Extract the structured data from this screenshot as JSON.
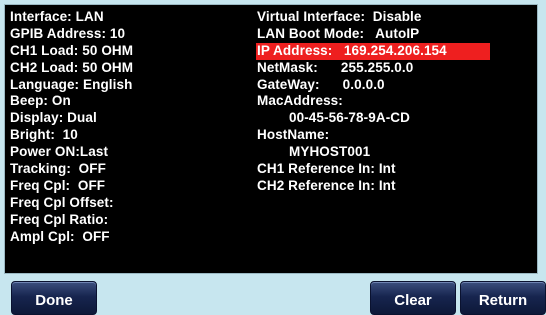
{
  "left_column": [
    "Interface: LAN",
    "GPIB Address: 10",
    "CH1 Load: 50 OHM",
    "CH2 Load: 50 OHM",
    "Language: English",
    "Beep: On",
    "Display: Dual",
    "Bright:  10",
    "Power ON:Last",
    "Tracking:  OFF",
    "Freq Cpl:  OFF",
    "Freq Cpl Offset:",
    "Freq Cpl Ratio:",
    "Ampl Cpl:  OFF"
  ],
  "right_column": {
    "virtual_interface": "Virtual Interface:  Disable",
    "lan_boot_mode": "LAN Boot Mode:   AutoIP",
    "ip_address": "IP Address:   169.254.206.154",
    "netmask": "NetMask:      255.255.0.0",
    "gateway": "GateWay:      0.0.0.0",
    "mac_address_label": "MacAddress:",
    "mac_address_value": "00-45-56-78-9A-CD",
    "hostname_label": "HostName:",
    "hostname_value": "MYHOST001",
    "ch1_reference": "CH1 Reference In: Int",
    "ch2_reference": "CH2 Reference In: Int"
  },
  "softkeys": {
    "done": "Done",
    "clear": "Clear",
    "return": "Return"
  },
  "colors": {
    "background": "#c7e6ef",
    "panel": "#000000",
    "highlight": "#ee1f1f",
    "text": "#ffffff",
    "softkey": "#17254f"
  }
}
